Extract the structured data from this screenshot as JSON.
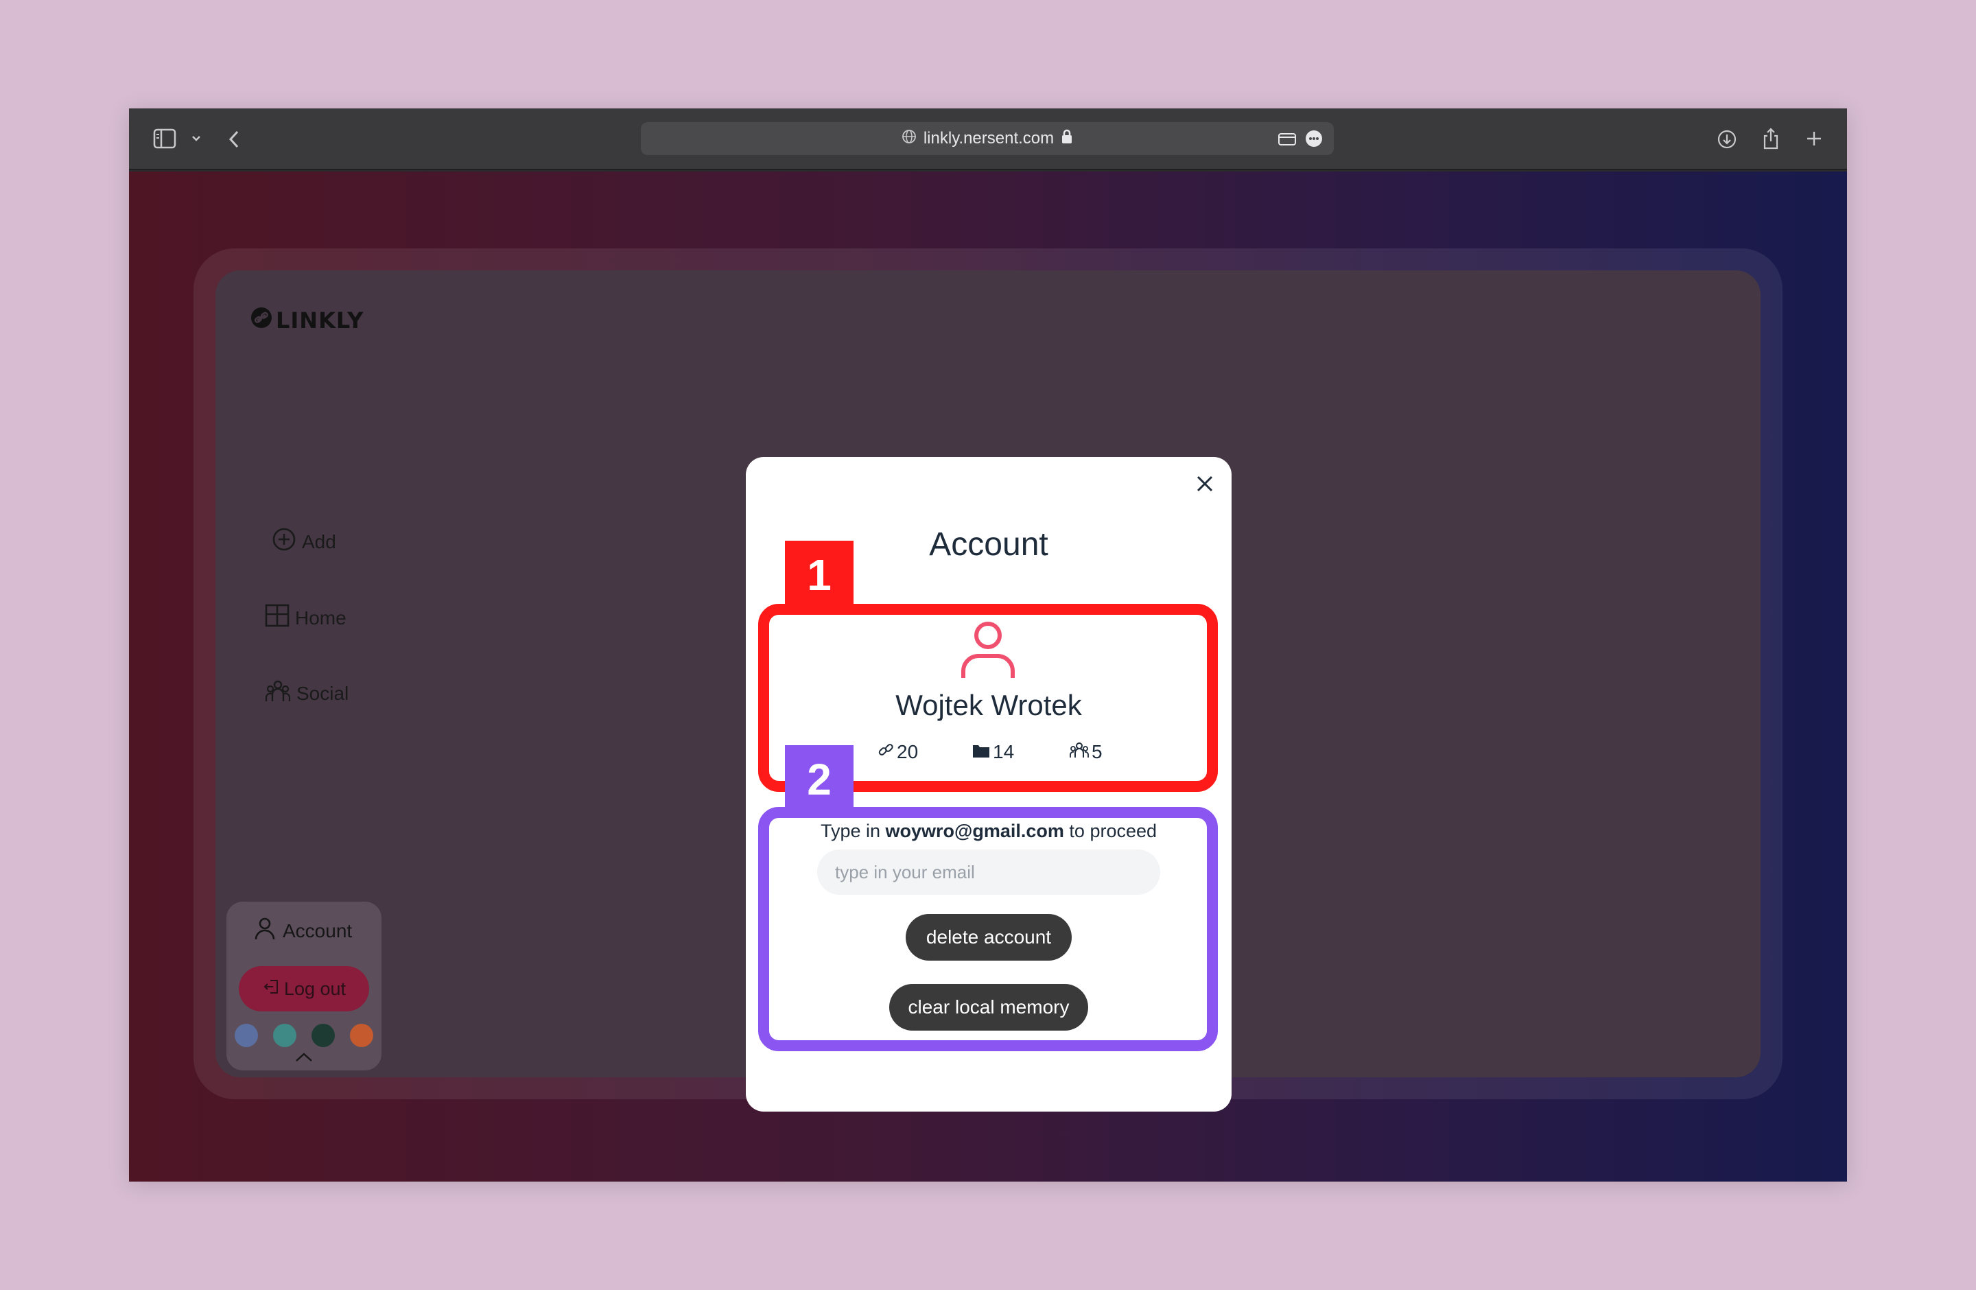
{
  "browser": {
    "url": "linkly.nersent.com"
  },
  "app": {
    "logo_text": "LINKLY",
    "nav": {
      "add": "Add",
      "home": "Home",
      "social": "Social"
    },
    "account_label": "Account",
    "logout_label": "Log out",
    "theme_colors": [
      "#5b6fa0",
      "#3f8a86",
      "#1d3a33",
      "#c45a2e"
    ]
  },
  "modal": {
    "title": "Account",
    "user_name": "Wojtek Wrotek",
    "stats": {
      "links": "20",
      "folders": "14",
      "friends": "5"
    },
    "prompt_before": "Type in ",
    "prompt_email": "woywro@gmail.com",
    "prompt_after": " to proceed",
    "email_placeholder": "type in your email",
    "delete_label": "delete account",
    "clear_label": "clear local memory"
  },
  "annotations": {
    "tag1": "1",
    "tag2": "2",
    "color1": "#ff1a1a",
    "color2": "#8a55f0"
  }
}
